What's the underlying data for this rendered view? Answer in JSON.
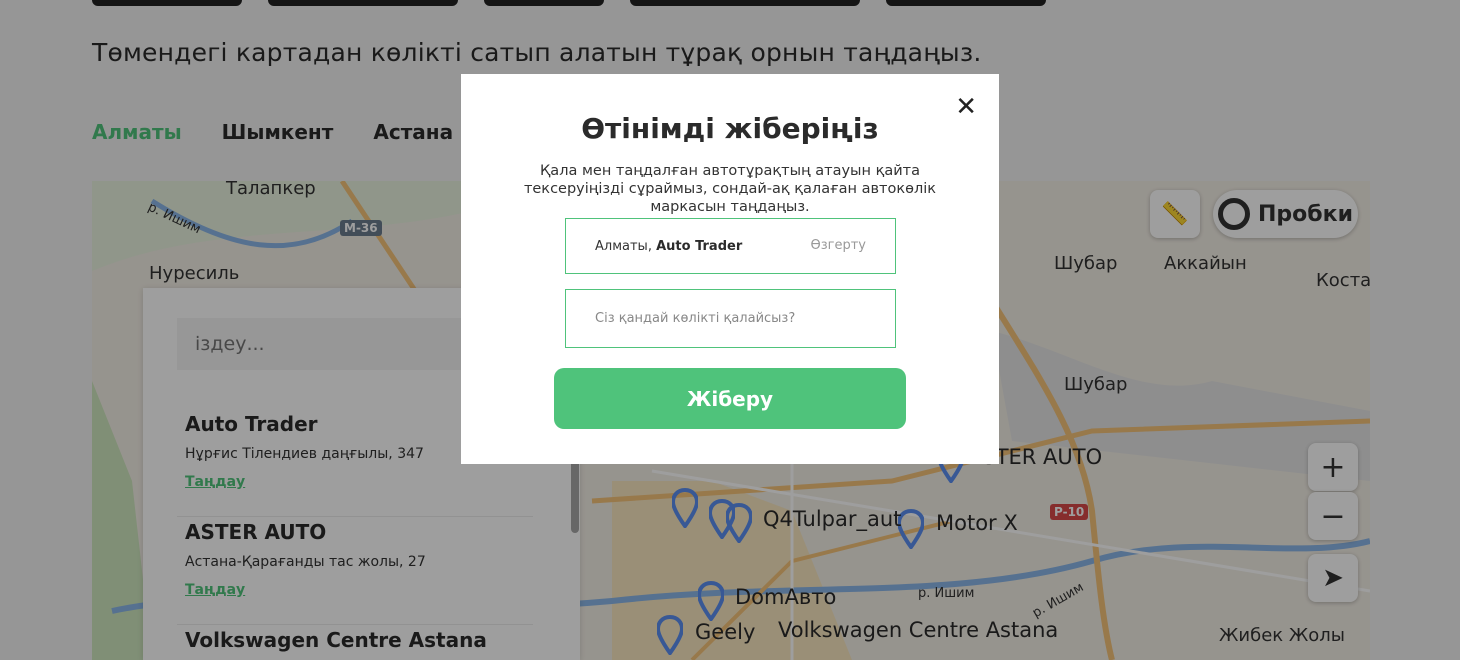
{
  "page": {
    "subtitle": "Төмендегі картадан көлікті сатып алатын тұрақ орнын таңдаңыз."
  },
  "cities": [
    {
      "label": "Алматы",
      "active": true
    },
    {
      "label": "Шымкент",
      "active": false
    },
    {
      "label": "Астана",
      "active": false
    }
  ],
  "map": {
    "place_labels": [
      "Талапкер",
      "Нуресиль",
      "Шубар",
      "Аккайын",
      "Костан",
      "Шубар",
      "Жибек Жолы",
      "р. Ишим",
      "р. Ишим",
      "р. Ишим"
    ],
    "road_badges": [
      "M-36",
      "P-10"
    ],
    "traffic_label": "Пробки",
    "zoom_in": "+",
    "zoom_out": "−",
    "pins": [
      "ASTER AUTO",
      "Q4Tulpar_aut",
      "Motor X",
      "DomАвто",
      "Geely",
      "Volkswagen Centre Astana"
    ]
  },
  "panel": {
    "search_placeholder": "іздеу...",
    "pick_label": "Таңдау",
    "dealers": [
      {
        "name": "Auto Trader",
        "address": "Нұрғис Тілендиев даңғылы, 347"
      },
      {
        "name": "ASTER AUTO",
        "address": "Астана-Қарағанды тас жолы, 27"
      },
      {
        "name": "Volkswagen Centre Astana",
        "address": ""
      }
    ]
  },
  "modal": {
    "title": "Өтінімді жіберіңіз",
    "close": "✕",
    "description": "Қала мен таңдалған автотұрақтың атауын қайта тексеруіңізді сұраймыз, сондай-ақ қалаған автокөлік маркасын таңдаңыз.",
    "city_prefix": "Алматы,",
    "dealer": "Auto Trader",
    "change_label": "Өзгерту",
    "car_placeholder": "Сіз қандай көлікті қалайсыз?",
    "submit_label": "Жіберу"
  },
  "colors": {
    "accent": "#4fc37b",
    "pin": "#5b8ff0",
    "road_badge": "#d84a4a"
  }
}
